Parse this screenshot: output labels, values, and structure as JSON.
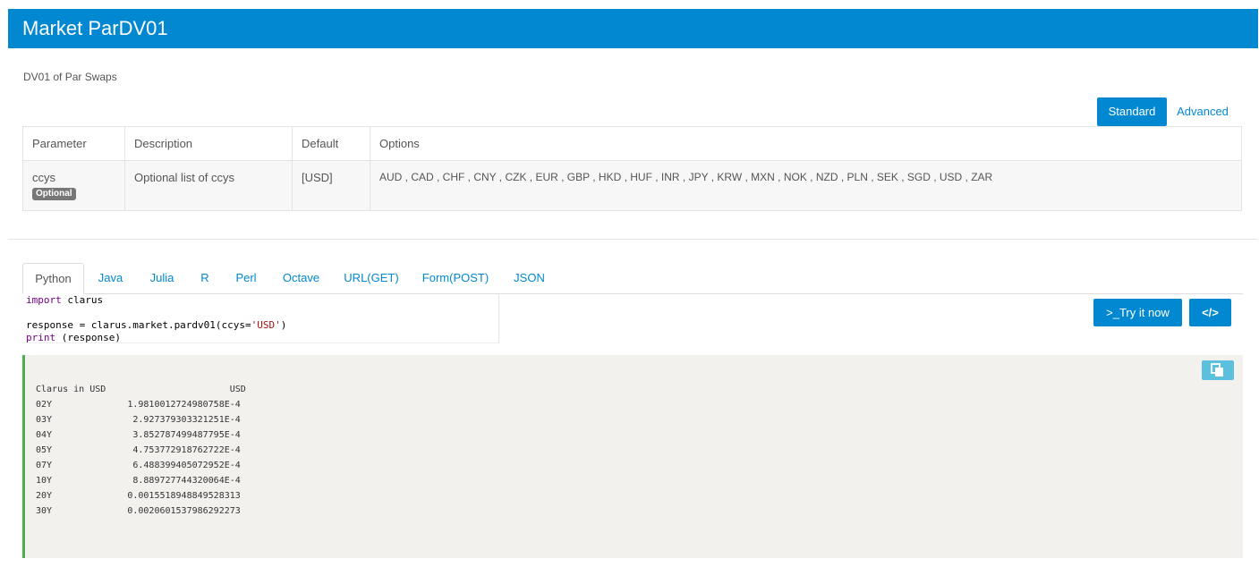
{
  "header": {
    "title": "Market ParDV01"
  },
  "subtitle": "DV01 of Par Swaps",
  "mode": {
    "standard": "Standard",
    "advanced": "Advanced"
  },
  "params_table": {
    "headers": [
      "Parameter",
      "Description",
      "Default",
      "Options"
    ],
    "rows": [
      {
        "parameter": "ccys",
        "badge": "Optional",
        "description": "Optional list of ccys",
        "default": "[USD]",
        "options": "AUD , CAD , CHF , CNY , CZK , EUR , GBP , HKD , HUF , INR , JPY , KRW , MXN , NOK , NZD , PLN , SEK , SGD , USD , ZAR"
      }
    ]
  },
  "tabs": [
    "Python",
    "Java",
    "Julia",
    "R",
    "Perl",
    "Octave",
    "URL(GET)",
    "Form(POST)",
    "JSON"
  ],
  "active_tab": "Python",
  "code": {
    "line1_kw": "import",
    "line1_rest": " clarus",
    "line3_pre": "response = clarus.market.pardv01(ccys=",
    "line3_str": "'USD'",
    "line3_post": ")",
    "line4_kw": "print",
    "line4_rest": " (response)"
  },
  "buttons": {
    "try": ">_Try it now",
    "code": "</>"
  },
  "output": {
    "text": "Clarus in USD                       USD\n02Y              1.9810012724980758E-4\n03Y               2.927379303321251E-4\n04Y               3.852787499487795E-4\n05Y               4.753772918762722E-4\n07Y               6.488399405072952E-4\n10Y               8.889727744320064E-4\n20Y              0.0015518948849528313\n30Y              0.0020601537986292273"
  },
  "icons": {
    "copy": "copy-icon"
  },
  "colors": {
    "primary": "#0288d1",
    "output_border": "#4caf50",
    "copy_button": "#5bc0de"
  }
}
